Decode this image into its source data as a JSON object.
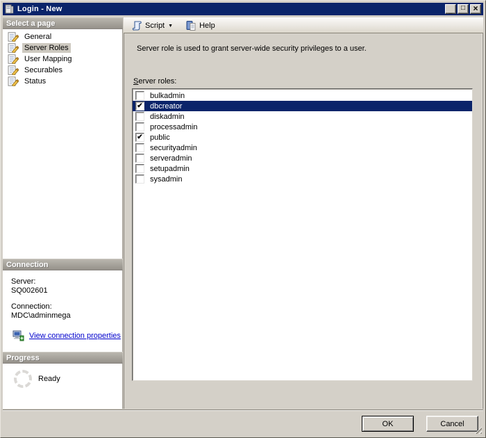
{
  "window": {
    "title": "Login - New",
    "controls": {
      "minimize": "_",
      "maximize": "□",
      "close": "×"
    }
  },
  "sidebar": {
    "select_page_header": "Select a page",
    "pages": [
      {
        "label": "General",
        "selected": false
      },
      {
        "label": "Server Roles",
        "selected": true
      },
      {
        "label": "User Mapping",
        "selected": false
      },
      {
        "label": "Securables",
        "selected": false
      },
      {
        "label": "Status",
        "selected": false
      }
    ],
    "connection_header": "Connection",
    "connection": {
      "server_label": "Server:",
      "server_value": "SQ002601",
      "connection_label": "Connection:",
      "connection_value": "MDC\\adminmega",
      "link_label": "View connection properties"
    },
    "progress_header": "Progress",
    "progress_status": "Ready"
  },
  "toolbar": {
    "script_label": "Script",
    "help_label": "Help"
  },
  "main": {
    "description": "Server role is used to grant server-wide security privileges to a user.",
    "roles_label": "Server roles:",
    "roles": [
      {
        "name": "bulkadmin",
        "checked": false,
        "selected": false
      },
      {
        "name": "dbcreator",
        "checked": true,
        "selected": true
      },
      {
        "name": "diskadmin",
        "checked": false,
        "selected": false
      },
      {
        "name": "processadmin",
        "checked": false,
        "selected": false
      },
      {
        "name": "public",
        "checked": true,
        "selected": false
      },
      {
        "name": "securityadmin",
        "checked": false,
        "selected": false
      },
      {
        "name": "serveradmin",
        "checked": false,
        "selected": false
      },
      {
        "name": "setupadmin",
        "checked": false,
        "selected": false
      },
      {
        "name": "sysadmin",
        "checked": false,
        "selected": false
      }
    ]
  },
  "footer": {
    "ok_label": "OK",
    "cancel_label": "Cancel"
  },
  "icons": {
    "dropdown_caret": "▼",
    "check": "✔"
  },
  "colors": {
    "titlebar": "#0a246a",
    "selection": "#0a246a",
    "window_gray": "#d4d0c8",
    "link_blue": "#0000cc"
  }
}
